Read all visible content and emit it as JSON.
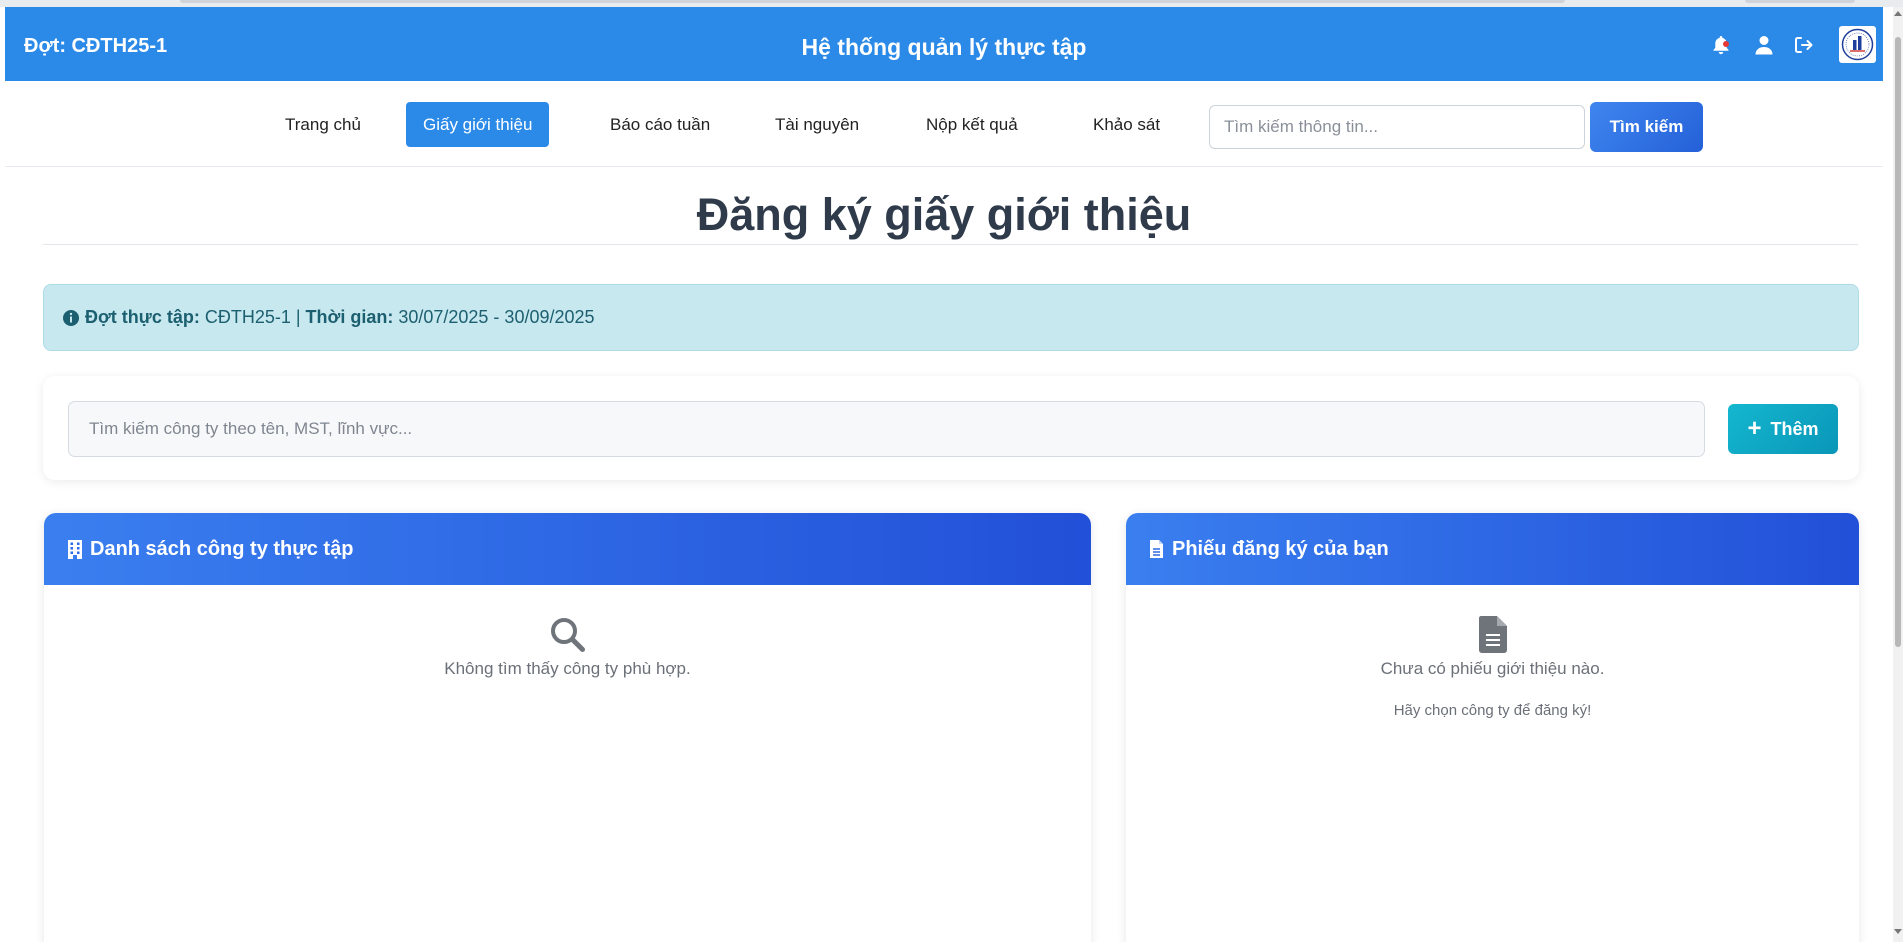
{
  "header": {
    "batch_label": "Đợt: CĐTH25-1",
    "system_title": "Hệ thống quản lý thực tập",
    "icons": [
      "bell-icon",
      "user-icon",
      "logout-icon"
    ]
  },
  "nav": {
    "items": [
      {
        "label": "Trang chủ"
      },
      {
        "label": "Giấy giới thiệu"
      },
      {
        "label": "Báo cáo tuần"
      },
      {
        "label": "Tài nguyên"
      },
      {
        "label": "Nộp kết quả"
      },
      {
        "label": "Khảo sát"
      }
    ],
    "active_index": 1,
    "search_placeholder": "Tìm kiếm thông tin...",
    "search_button": "Tìm kiếm"
  },
  "page": {
    "title": "Đăng ký giấy giới thiệu"
  },
  "alert": {
    "period_label": "Đợt thực tập:",
    "period_value": "CĐTH25-1",
    "separator": "|",
    "time_label": "Thời gian:",
    "time_value": "30/07/2025 - 30/09/2025"
  },
  "company_search": {
    "placeholder": "Tìm kiếm công ty theo tên, MST, lĩnh vực...",
    "add_button": "Thêm"
  },
  "companies_panel": {
    "title": "Danh sách công ty thực tập",
    "empty_text": "Không tìm thấy công ty phù hợp."
  },
  "applications_panel": {
    "title": "Phiếu đăng ký của bạn",
    "empty_text": "Chưa có phiếu giới thiệu nào.",
    "hint_text": "Hãy chọn công ty để đăng ký!"
  },
  "colors": {
    "primary": "#2b8ae8",
    "panel_header": "#2250d8",
    "info_bg": "#c7e8ee",
    "add_button": "#14b7cf"
  }
}
